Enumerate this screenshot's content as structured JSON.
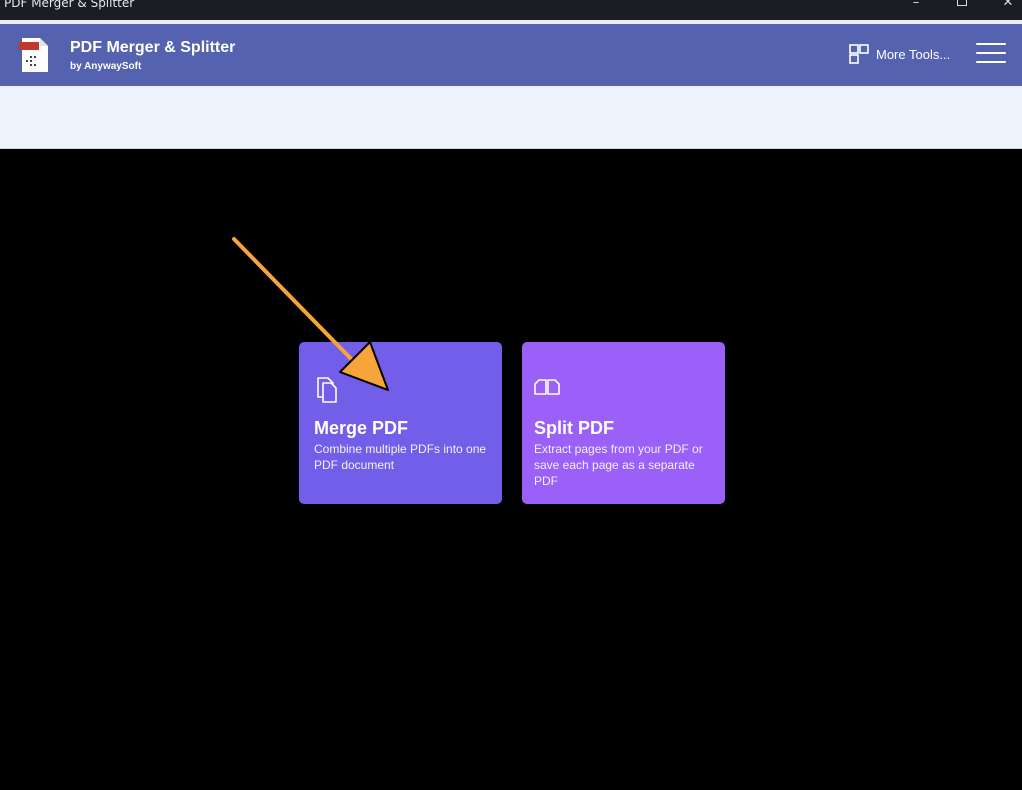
{
  "window": {
    "title": "PDF Merger & Splitter",
    "minimize_glyph": "–",
    "close_glyph": "✕"
  },
  "header": {
    "app_title": "PDF Merger & Splitter",
    "app_subtitle": "by AnywaySoft",
    "more_tools_label": "More Tools...",
    "logo_icon": "pdf-file-icon",
    "more_tools_icon": "tiles-icon",
    "menu_icon": "hamburger-menu-icon"
  },
  "cards": [
    {
      "title": "Merge PDF",
      "description": "Combine multiple PDFs into one PDF document",
      "icon": "copy-pages-icon"
    },
    {
      "title": "Split PDF",
      "description": "Extract pages from your PDF or save each page as a separate PDF",
      "icon": "split-pages-icon"
    }
  ],
  "colors": {
    "header_bg": "#5462b0",
    "merge_card": "#735ee9",
    "split_card": "#9a60f7",
    "annotation_arrow": "#f7a43b"
  }
}
